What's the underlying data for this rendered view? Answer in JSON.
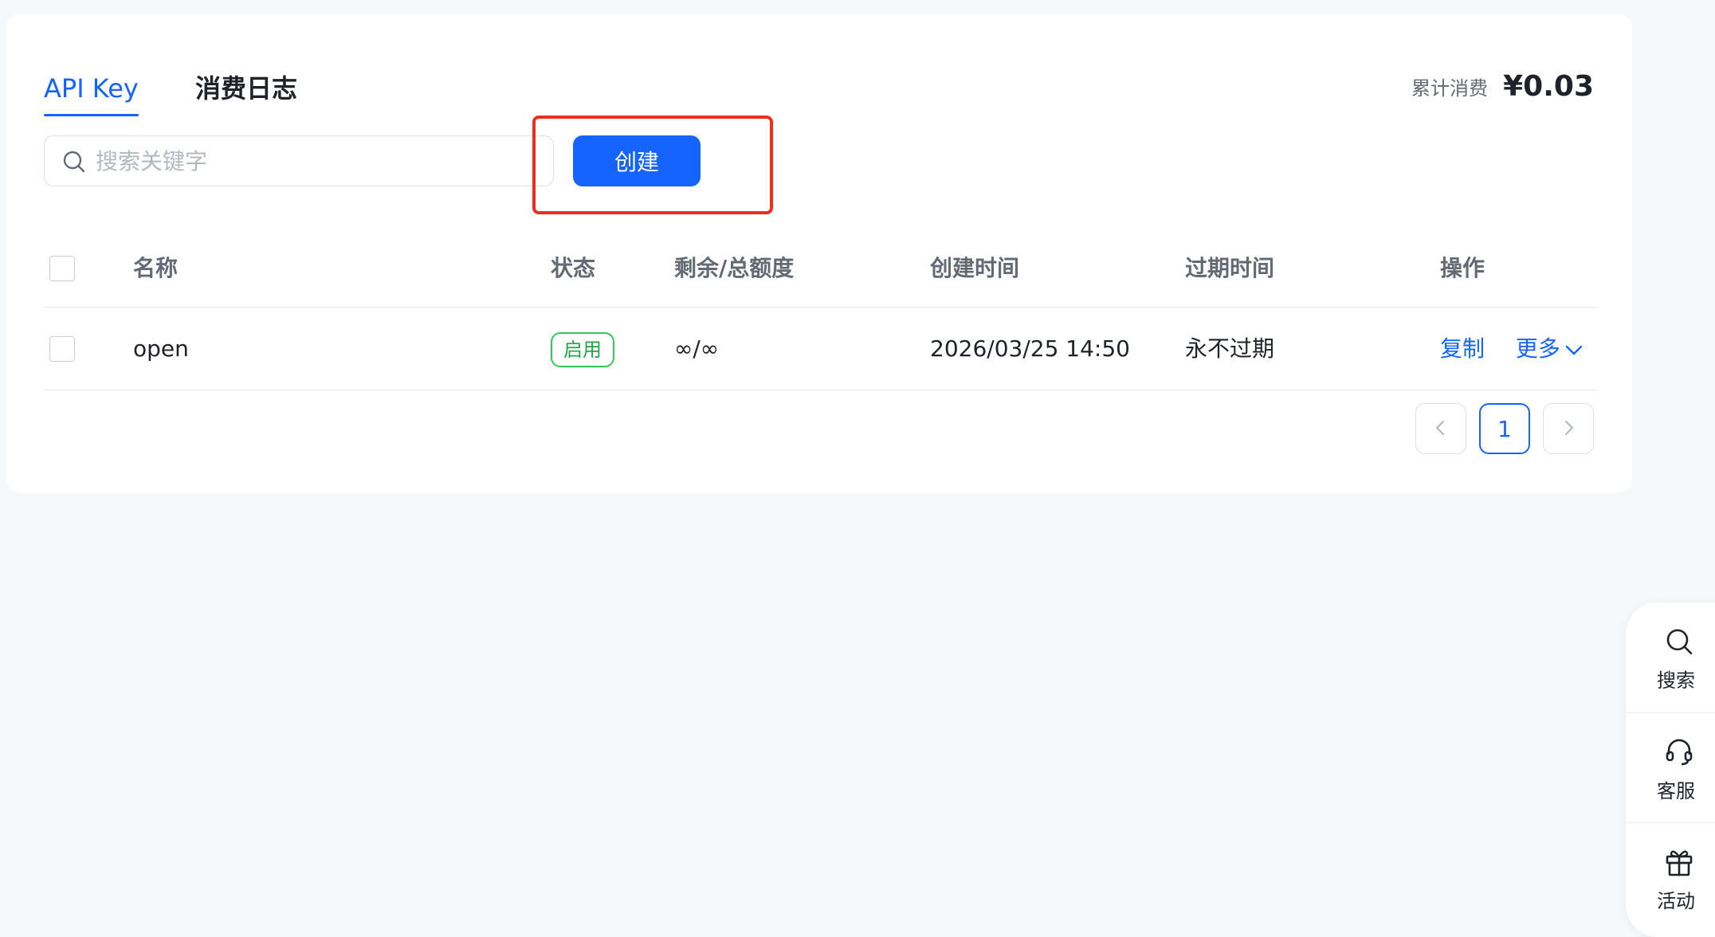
{
  "tabs": {
    "api_key": "API Key",
    "consumption_log": "消费日志"
  },
  "summary": {
    "label": "累计消费",
    "value": "¥0.03"
  },
  "search": {
    "placeholder": "搜索关键字"
  },
  "toolbar": {
    "create_label": "创建"
  },
  "table": {
    "headers": {
      "name": "名称",
      "status": "状态",
      "quota": "剩余/总额度",
      "created": "创建时间",
      "expire": "过期时间",
      "ops": "操作"
    },
    "rows": [
      {
        "name": "open",
        "status": "启用",
        "quota": "∞/∞",
        "created": "2026/03/25 14:50",
        "expire": "永不过期",
        "copy": "复制",
        "more": "更多"
      }
    ]
  },
  "pagination": {
    "current": "1"
  },
  "float_panel": {
    "search": "搜索",
    "support": "客服",
    "activity": "活动"
  },
  "colors": {
    "accent": "#1664ff",
    "highlight": "#e8321e",
    "status_enabled": "#34c759"
  }
}
